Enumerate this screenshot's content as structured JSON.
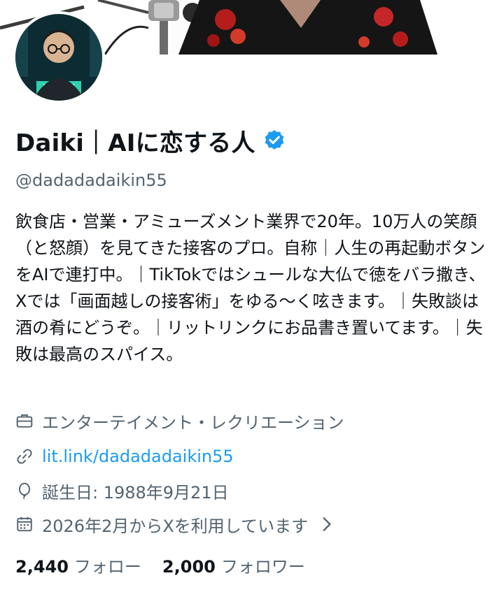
{
  "profile": {
    "display_name": "Daiki｜AIに恋する人",
    "handle": "@dadadadaikin55",
    "bio": "飲食店・営業・アミューズメント業界で20年。10万人の笑顔（と怒顔）を見てきた接客のプロ。自称｜人生の再起動ボタンをAIで連打中。｜TikTokではシュールな大仏で徳をバラ撒き、Xでは「画面越しの接客術」をゆる〜く呟きます。｜失敗談は酒の肴にどうぞ。｜リットリンクにお品書き置いてます。｜失敗は最高のスパイス。",
    "category": "エンターテイメント・レクリエーション",
    "link": "lit.link/dadadadaikin55",
    "birthday": "誕生日: 1988年9月21日",
    "joined": "2026年2月からXを利用しています",
    "following_count": "2,440",
    "following_label": "フォロー",
    "followers_count": "2,000",
    "followers_label": "フォロワー"
  },
  "icons": {
    "verified": "verified-badge-icon",
    "category": "briefcase-icon",
    "link": "link-icon",
    "birthday": "balloon-icon",
    "joined": "calendar-icon",
    "chevron": "chevron-right-icon"
  },
  "colors": {
    "accent": "#1d9bf0",
    "secondary_text": "#536471",
    "primary_text": "#0f1419"
  }
}
